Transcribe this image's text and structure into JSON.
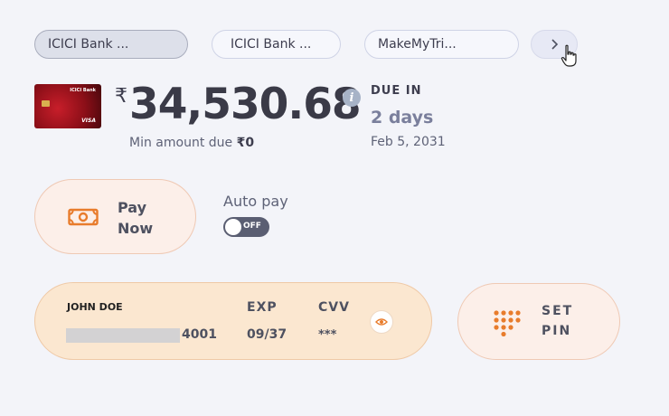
{
  "tabs": [
    {
      "label": "ICICI Bank ...",
      "active": true
    },
    {
      "label": "ICICI Bank ...",
      "active": false
    },
    {
      "label": "MakeMyTri...",
      "active": false
    }
  ],
  "tab_next_icon": "chevron-right-icon",
  "card_thumb": {
    "bank_logo": "ICICI Bank",
    "network": "VISA"
  },
  "balance": {
    "currency_symbol": "₹",
    "amount": "34,530.68",
    "min_due_label": "Min amount due",
    "min_due_value": "₹0"
  },
  "due": {
    "label": "DUE IN",
    "days": "2 days",
    "date": "Feb 5, 2031"
  },
  "pay_now": {
    "label": "Pay Now",
    "icon": "cash-icon"
  },
  "autopay": {
    "label": "Auto pay",
    "state": "OFF"
  },
  "card": {
    "holder": "JOHN DOE",
    "last4": "4001",
    "exp_label": "EXP",
    "exp": "09/37",
    "cvv_label": "CVV",
    "cvv": "***",
    "reveal_icon": "eye-icon"
  },
  "set_pin": {
    "label": "SET PIN",
    "icon": "keypad-icon"
  },
  "colors": {
    "accent": "#e87c2c",
    "card_bg": "#fbe7d0",
    "button_bg": "#fcefe9",
    "background": "#f3f4f9"
  }
}
